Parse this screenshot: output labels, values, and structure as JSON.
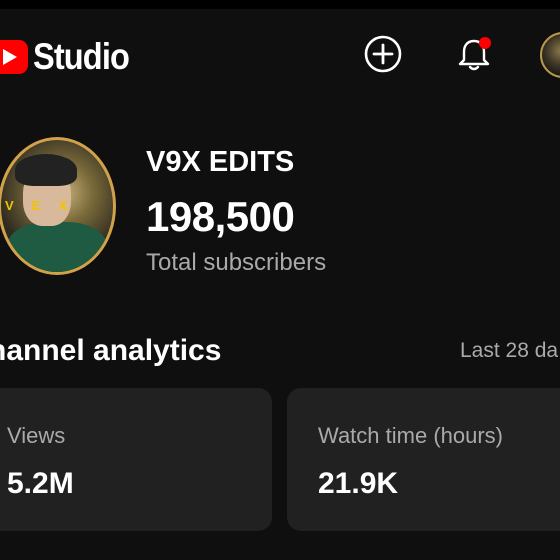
{
  "app": {
    "name": "Studio"
  },
  "header": {
    "create_icon": "add-circle-icon",
    "notifications_icon": "bell-icon",
    "notification_dot_color": "#ff0000",
    "account_icon": "account-avatar"
  },
  "channel": {
    "name": "V9X EDITS",
    "subscriber_count": "198,500",
    "subscriber_label": "Total subscribers"
  },
  "analytics": {
    "title": "hannel analytics",
    "period": "Last 28 da",
    "cards": [
      {
        "label": "Views",
        "value": "5.2M"
      },
      {
        "label": "Watch time (hours)",
        "value": "21.9K"
      }
    ]
  },
  "colors": {
    "background": "#0f0f0f",
    "card": "#212121",
    "brand_red": "#ff0000",
    "secondary_text": "#aaaaaa"
  }
}
